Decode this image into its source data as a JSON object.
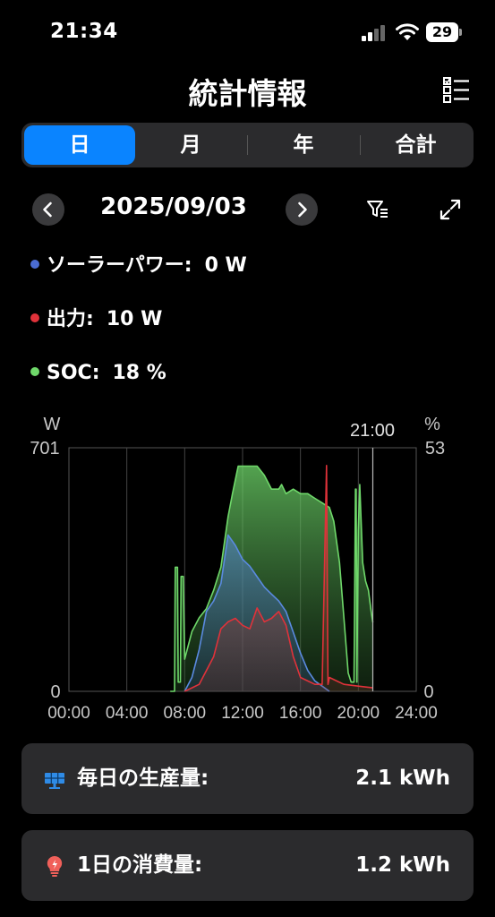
{
  "status_bar": {
    "time": "21:34",
    "battery": "29"
  },
  "nav": {
    "title": "統計情報"
  },
  "segments": [
    {
      "label": "日",
      "active": true
    },
    {
      "label": "月",
      "active": false
    },
    {
      "label": "年",
      "active": false
    },
    {
      "label": "合計",
      "active": false
    }
  ],
  "date": "2025/09/03",
  "legend": [
    {
      "label": "ソーラーパワー:",
      "value": "0 W",
      "color": "#4a6cd4"
    },
    {
      "label": "出力:",
      "value": "10 W",
      "color": "#e0323a"
    },
    {
      "label": "SOC:",
      "value": "18 %",
      "color": "#6fd86a"
    }
  ],
  "chart_data": {
    "type": "area",
    "left_unit": "W",
    "right_unit": "%",
    "left_max_label": "701",
    "right_max_label": "53",
    "left_min_label": "0",
    "right_min_label": "0",
    "cursor_label": "21:00",
    "x_ticks": [
      "00:00",
      "04:00",
      "08:00",
      "12:00",
      "16:00",
      "20:00",
      "24:00"
    ],
    "xlim": [
      0,
      24
    ],
    "ylim_left": [
      0,
      701
    ],
    "ylim_right": [
      0,
      53
    ],
    "cursor_x": 21,
    "series": [
      {
        "name": "SOC",
        "axis": "right",
        "color": "#6fd86a",
        "x": [
          7.0,
          7.3,
          7.35,
          7.5,
          7.55,
          7.7,
          7.75,
          7.9,
          8.0,
          8.5,
          9.0,
          9.5,
          10.0,
          10.5,
          11.0,
          11.3,
          11.5,
          11.7,
          12.0,
          12.5,
          13.0,
          13.5,
          14.0,
          14.5,
          14.7,
          15.0,
          15.5,
          16.0,
          16.5,
          17.0,
          17.5,
          18.0,
          18.3,
          18.7,
          19.0,
          19.3,
          19.5,
          19.7,
          19.8,
          19.85,
          19.9,
          20.0,
          20.1,
          20.3,
          20.5,
          20.7,
          20.9,
          21.0
        ],
        "y": [
          0,
          0,
          27,
          27,
          2,
          2,
          25,
          25,
          7,
          13,
          16,
          18,
          22,
          27,
          38,
          43,
          46,
          49,
          49,
          49,
          49,
          47,
          44,
          44,
          45,
          43,
          44,
          43,
          43,
          42,
          41,
          40,
          37,
          28,
          16,
          4,
          2,
          2,
          44,
          44,
          2,
          35,
          45,
          28,
          24,
          22,
          17,
          15
        ]
      },
      {
        "name": "ソーラーパワー",
        "axis": "left",
        "color": "#5a8ae0",
        "x": [
          8.0,
          8.5,
          9.0,
          9.5,
          10.0,
          10.5,
          11.0,
          11.5,
          12.0,
          12.5,
          13.0,
          13.5,
          14.0,
          14.5,
          15.0,
          15.5,
          16.0,
          16.5,
          17.0,
          17.5,
          18.0
        ],
        "y": [
          0,
          40,
          120,
          230,
          260,
          310,
          450,
          420,
          380,
          360,
          330,
          300,
          280,
          260,
          230,
          170,
          110,
          60,
          30,
          15,
          0
        ]
      },
      {
        "name": "出力",
        "axis": "left",
        "color": "#e0323a",
        "x": [
          8.0,
          8.5,
          9.0,
          9.5,
          10.0,
          10.5,
          11.0,
          11.5,
          12.0,
          12.5,
          13.0,
          13.5,
          14.0,
          14.5,
          15.0,
          15.5,
          16.0,
          16.5,
          17.0,
          17.5,
          17.8,
          17.9,
          18.0,
          18.5,
          19.0,
          20.0,
          21.0
        ],
        "y": [
          0,
          10,
          20,
          60,
          100,
          180,
          200,
          210,
          190,
          180,
          240,
          200,
          210,
          230,
          190,
          100,
          40,
          30,
          20,
          20,
          650,
          20,
          40,
          30,
          20,
          15,
          10
        ]
      }
    ]
  },
  "cards": [
    {
      "label": "毎日の生産量:",
      "value": "2.1 kWh",
      "icon": "solar-panel-icon"
    },
    {
      "label": "1日の消費量:",
      "value": "1.2 kWh",
      "icon": "lightbulb-icon"
    }
  ]
}
